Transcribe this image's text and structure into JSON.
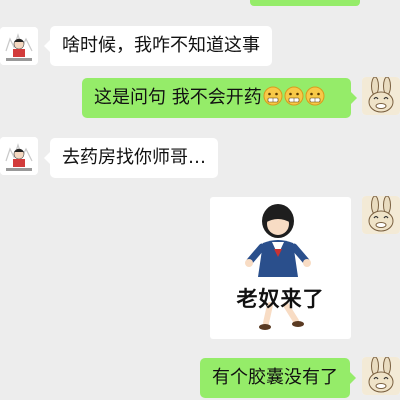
{
  "messages": [
    {
      "side": "left",
      "text": "啥时候，我咋不知道这事"
    },
    {
      "side": "right",
      "text": "这是问句 我不会开药"
    },
    {
      "side": "left",
      "text": "去药房找你师哥…"
    },
    {
      "side": "right",
      "sticker_caption": "老奴来了"
    },
    {
      "side": "right",
      "text": "有个胶囊没有了"
    }
  ],
  "colors": {
    "background": "#ededed",
    "incoming_bubble": "#ffffff",
    "outgoing_bubble": "#95ec69"
  },
  "icons": {
    "left_avatar": "doctor-cartoon-avatar",
    "right_avatar": "bunny-cartoon-avatar",
    "emoji": "grimace-emoji"
  }
}
